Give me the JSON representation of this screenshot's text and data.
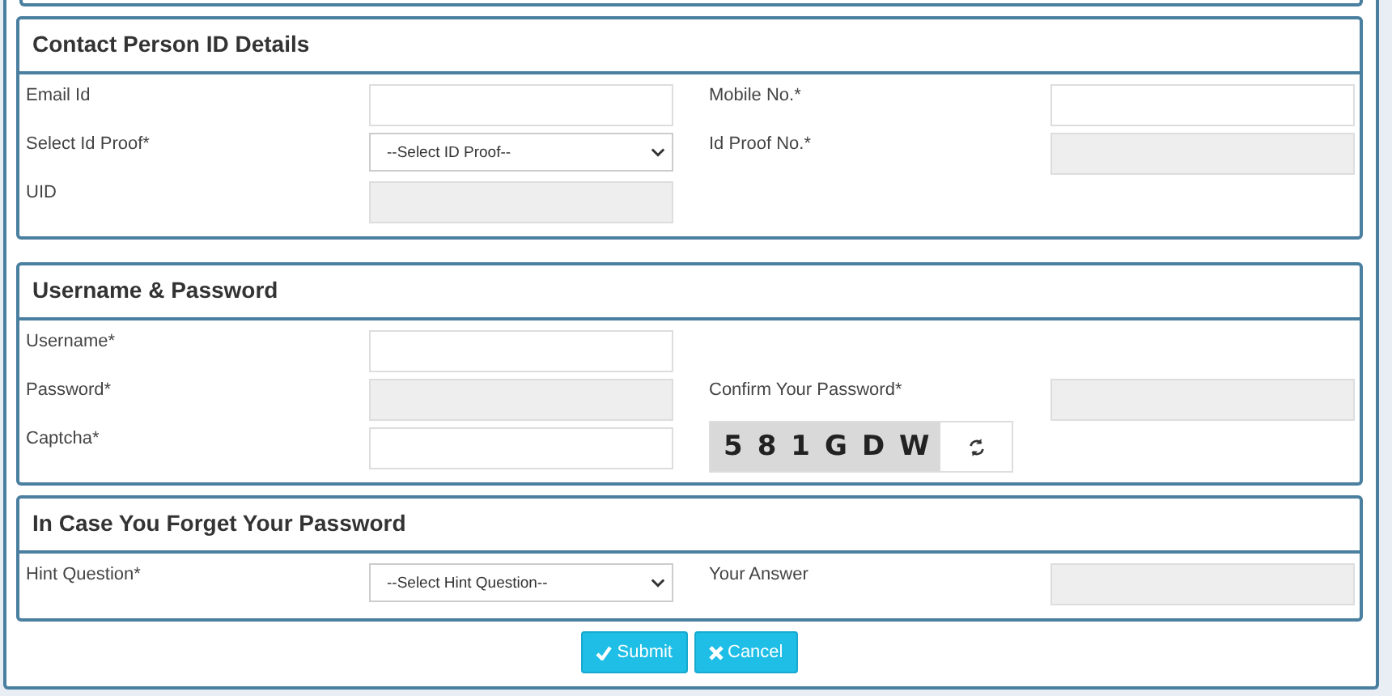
{
  "sections": [
    {
      "title": "Contact Person ID Details",
      "rows": [
        [
          {
            "label": "Email Id",
            "kind": "text",
            "disabled": false
          },
          {
            "label": "Mobile No.*",
            "kind": "text",
            "disabled": false
          }
        ],
        [
          {
            "label": "Select Id Proof*",
            "kind": "select",
            "value": "--Select ID Proof--"
          },
          {
            "label": "Id Proof No.*",
            "kind": "text",
            "disabled": true
          }
        ],
        [
          {
            "label": "UID",
            "kind": "text",
            "disabled": true
          }
        ]
      ]
    },
    {
      "title": "Username & Password",
      "rows": [
        [
          {
            "label": "Username*",
            "kind": "text",
            "disabled": false
          }
        ],
        [
          {
            "label": "Password*",
            "kind": "text",
            "disabled": true
          },
          {
            "label": "Confirm Your Password*",
            "kind": "text",
            "disabled": true
          }
        ],
        [
          {
            "label": "Captcha*",
            "kind": "text",
            "disabled": false
          },
          {
            "kind": "captcha",
            "code": "581GDW"
          }
        ]
      ]
    },
    {
      "title": "In Case You Forget Your Password",
      "rows": [
        [
          {
            "label": "Hint Question*",
            "kind": "select",
            "value": "--Select Hint Question--"
          },
          {
            "label": "Your Answer",
            "kind": "text",
            "disabled": true
          }
        ]
      ]
    }
  ],
  "buttons": [
    {
      "label": "Submit",
      "kind": "submit"
    },
    {
      "label": "Cancel",
      "kind": "cancel"
    }
  ]
}
